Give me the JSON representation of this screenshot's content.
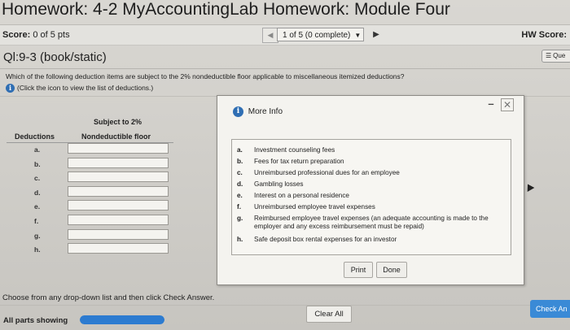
{
  "header": {
    "title": "Homework: 4-2 MyAccountingLab Homework: Module Four"
  },
  "scorebar": {
    "score_label": "Score:",
    "score_value": "0 of 5 pts",
    "question_selector": "1 of 5 (0 complete)",
    "hw_score_label": "HW Score:"
  },
  "question": {
    "id": "Ql:9-3 (book/static)",
    "menu_label": "Que",
    "text": "Which of the following deduction items are subject to the 2% nondeductible floor applicable to miscellaneous itemized deductions?",
    "hint": "(Click the icon to view the list of deductions.)"
  },
  "answer_table": {
    "header_top": "Subject to 2%",
    "col_deductions": "Deductions",
    "col_floor": "Nondeductible floor",
    "rows": [
      {
        "label": "a.",
        "value": ""
      },
      {
        "label": "b.",
        "value": ""
      },
      {
        "label": "c.",
        "value": ""
      },
      {
        "label": "d.",
        "value": ""
      },
      {
        "label": "e.",
        "value": ""
      },
      {
        "label": "f.",
        "value": ""
      },
      {
        "label": "g.",
        "value": ""
      },
      {
        "label": "h.",
        "value": ""
      }
    ]
  },
  "modal": {
    "title": "More Info",
    "items": [
      {
        "letter": "a.",
        "text": "Investment counseling fees"
      },
      {
        "letter": "b.",
        "text": "Fees for tax return preparation"
      },
      {
        "letter": "c.",
        "text": "Unreimbursed professional dues for an employee"
      },
      {
        "letter": "d.",
        "text": "Gambling losses"
      },
      {
        "letter": "e.",
        "text": "Interest on a personal residence"
      },
      {
        "letter": "f.",
        "text": "Unreimbursed employee travel expenses"
      },
      {
        "letter": "g.",
        "text": "Reimbursed employee travel expenses (an adequate accounting is made to the employer and any excess reimbursement must be repaid)"
      },
      {
        "letter": "h.",
        "text": "Safe deposit box rental expenses for an investor"
      }
    ],
    "print_label": "Print",
    "done_label": "Done"
  },
  "footer": {
    "instruction": "Choose from any drop-down list and then click Check Answer.",
    "all_parts": "All parts showing",
    "progress": 1.0,
    "clear_all": "Clear All",
    "check_answer": "Check An"
  },
  "colors": {
    "accent": "#2c7bd0",
    "check_button": "#3a8ad6",
    "info_icon": "#2f6eb3"
  }
}
